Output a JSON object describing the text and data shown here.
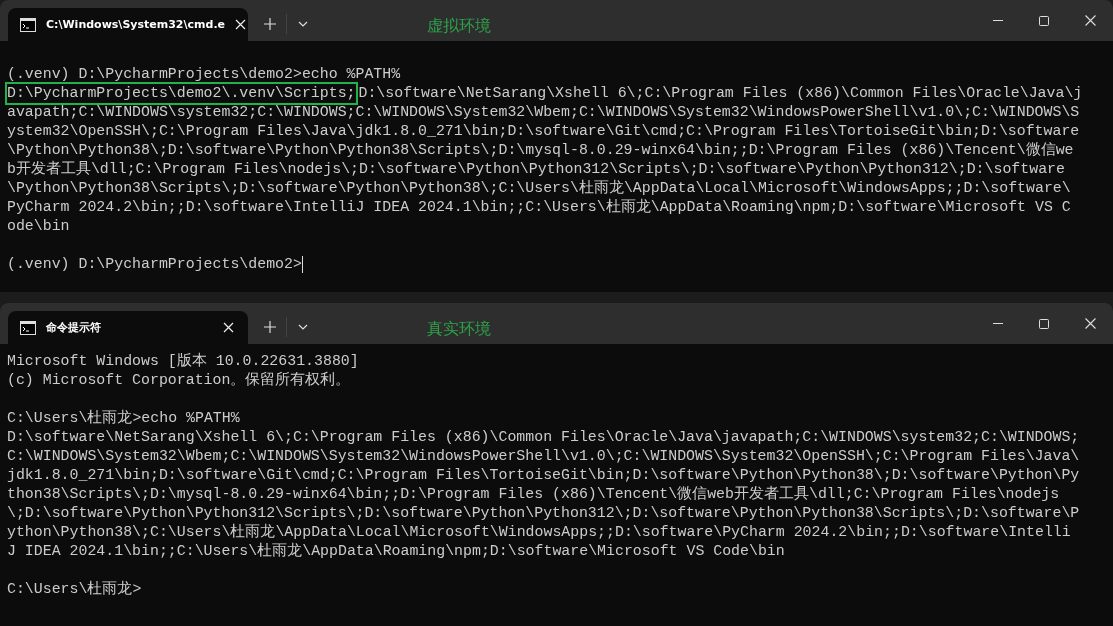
{
  "windows": [
    {
      "tab": {
        "title": "C:\\Windows\\System32\\cmd.e",
        "selected": true
      },
      "annotation": "虚拟环境",
      "cursor": true,
      "blocks": [
        [
          "(.venv) D:\\PycharmProjects\\demo2>echo %PATH%",
          {
            "highlight": "D:\\PycharmProjects\\demo2\\.venv\\Scripts;",
            "text": "D:\\software\\NetSarang\\Xshell 6\\;C:\\Program Files (x86)\\Common Files\\Oracle\\Java\\j"
          },
          "avapath;C:\\WINDOWS\\system32;C:\\WINDOWS;C:\\WINDOWS\\System32\\Wbem;C:\\WINDOWS\\System32\\WindowsPowerShell\\v1.0\\;C:\\WINDOWS\\S",
          "ystem32\\OpenSSH\\;C:\\Program Files\\Java\\jdk1.8.0_271\\bin;D:\\software\\Git\\cmd;C:\\Program Files\\TortoiseGit\\bin;D:\\software",
          "\\Python\\Python38\\;D:\\software\\Python\\Python38\\Scripts\\;D:\\mysql-8.0.29-winx64\\bin;;D:\\Program Files (x86)\\Tencent\\微信we",
          "b开发者工具\\dll;C:\\Program Files\\nodejs\\;D:\\software\\Python\\Python312\\Scripts\\;D:\\software\\Python\\Python312\\;D:\\software",
          "\\Python\\Python38\\Scripts\\;D:\\software\\Python\\Python38\\;C:\\Users\\杜雨龙\\AppData\\Local\\Microsoft\\WindowsApps;;D:\\software\\",
          "PyCharm 2024.2\\bin;;D:\\software\\IntelliJ IDEA 2024.1\\bin;;C:\\Users\\杜雨龙\\AppData\\Roaming\\npm;D:\\software\\Microsoft VS C",
          "ode\\bin"
        ],
        [
          "(.venv) D:\\PycharmProjects\\demo2>"
        ]
      ]
    },
    {
      "tab": {
        "title": "命令提示符",
        "selected": true
      },
      "annotation": "真实环境",
      "cursor": false,
      "blocks": [
        [
          "Microsoft Windows [版本 10.0.22631.3880]",
          "(c) Microsoft Corporation。保留所有权利。"
        ],
        [
          "C:\\Users\\杜雨龙>echo %PATH%",
          "D:\\software\\NetSarang\\Xshell 6\\;C:\\Program Files (x86)\\Common Files\\Oracle\\Java\\javapath;C:\\WINDOWS\\system32;C:\\WINDOWS;",
          "C:\\WINDOWS\\System32\\Wbem;C:\\WINDOWS\\System32\\WindowsPowerShell\\v1.0\\;C:\\WINDOWS\\System32\\OpenSSH\\;C:\\Program Files\\Java\\",
          "jdk1.8.0_271\\bin;D:\\software\\Git\\cmd;C:\\Program Files\\TortoiseGit\\bin;D:\\software\\Python\\Python38\\;D:\\software\\Python\\Py",
          "thon38\\Scripts\\;D:\\mysql-8.0.29-winx64\\bin;;D:\\Program Files (x86)\\Tencent\\微信web开发者工具\\dll;C:\\Program Files\\nodejs",
          "\\;D:\\software\\Python\\Python312\\Scripts\\;D:\\software\\Python\\Python312\\;D:\\software\\Python\\Python38\\Scripts\\;D:\\software\\P",
          "ython\\Python38\\;C:\\Users\\杜雨龙\\AppData\\Local\\Microsoft\\WindowsApps;;D:\\software\\PyCharm 2024.2\\bin;;D:\\software\\Intelli",
          "J IDEA 2024.1\\bin;;C:\\Users\\杜雨龙\\AppData\\Roaming\\npm;D:\\software\\Microsoft VS Code\\bin"
        ],
        [
          "C:\\Users\\杜雨龙>"
        ]
      ]
    }
  ]
}
